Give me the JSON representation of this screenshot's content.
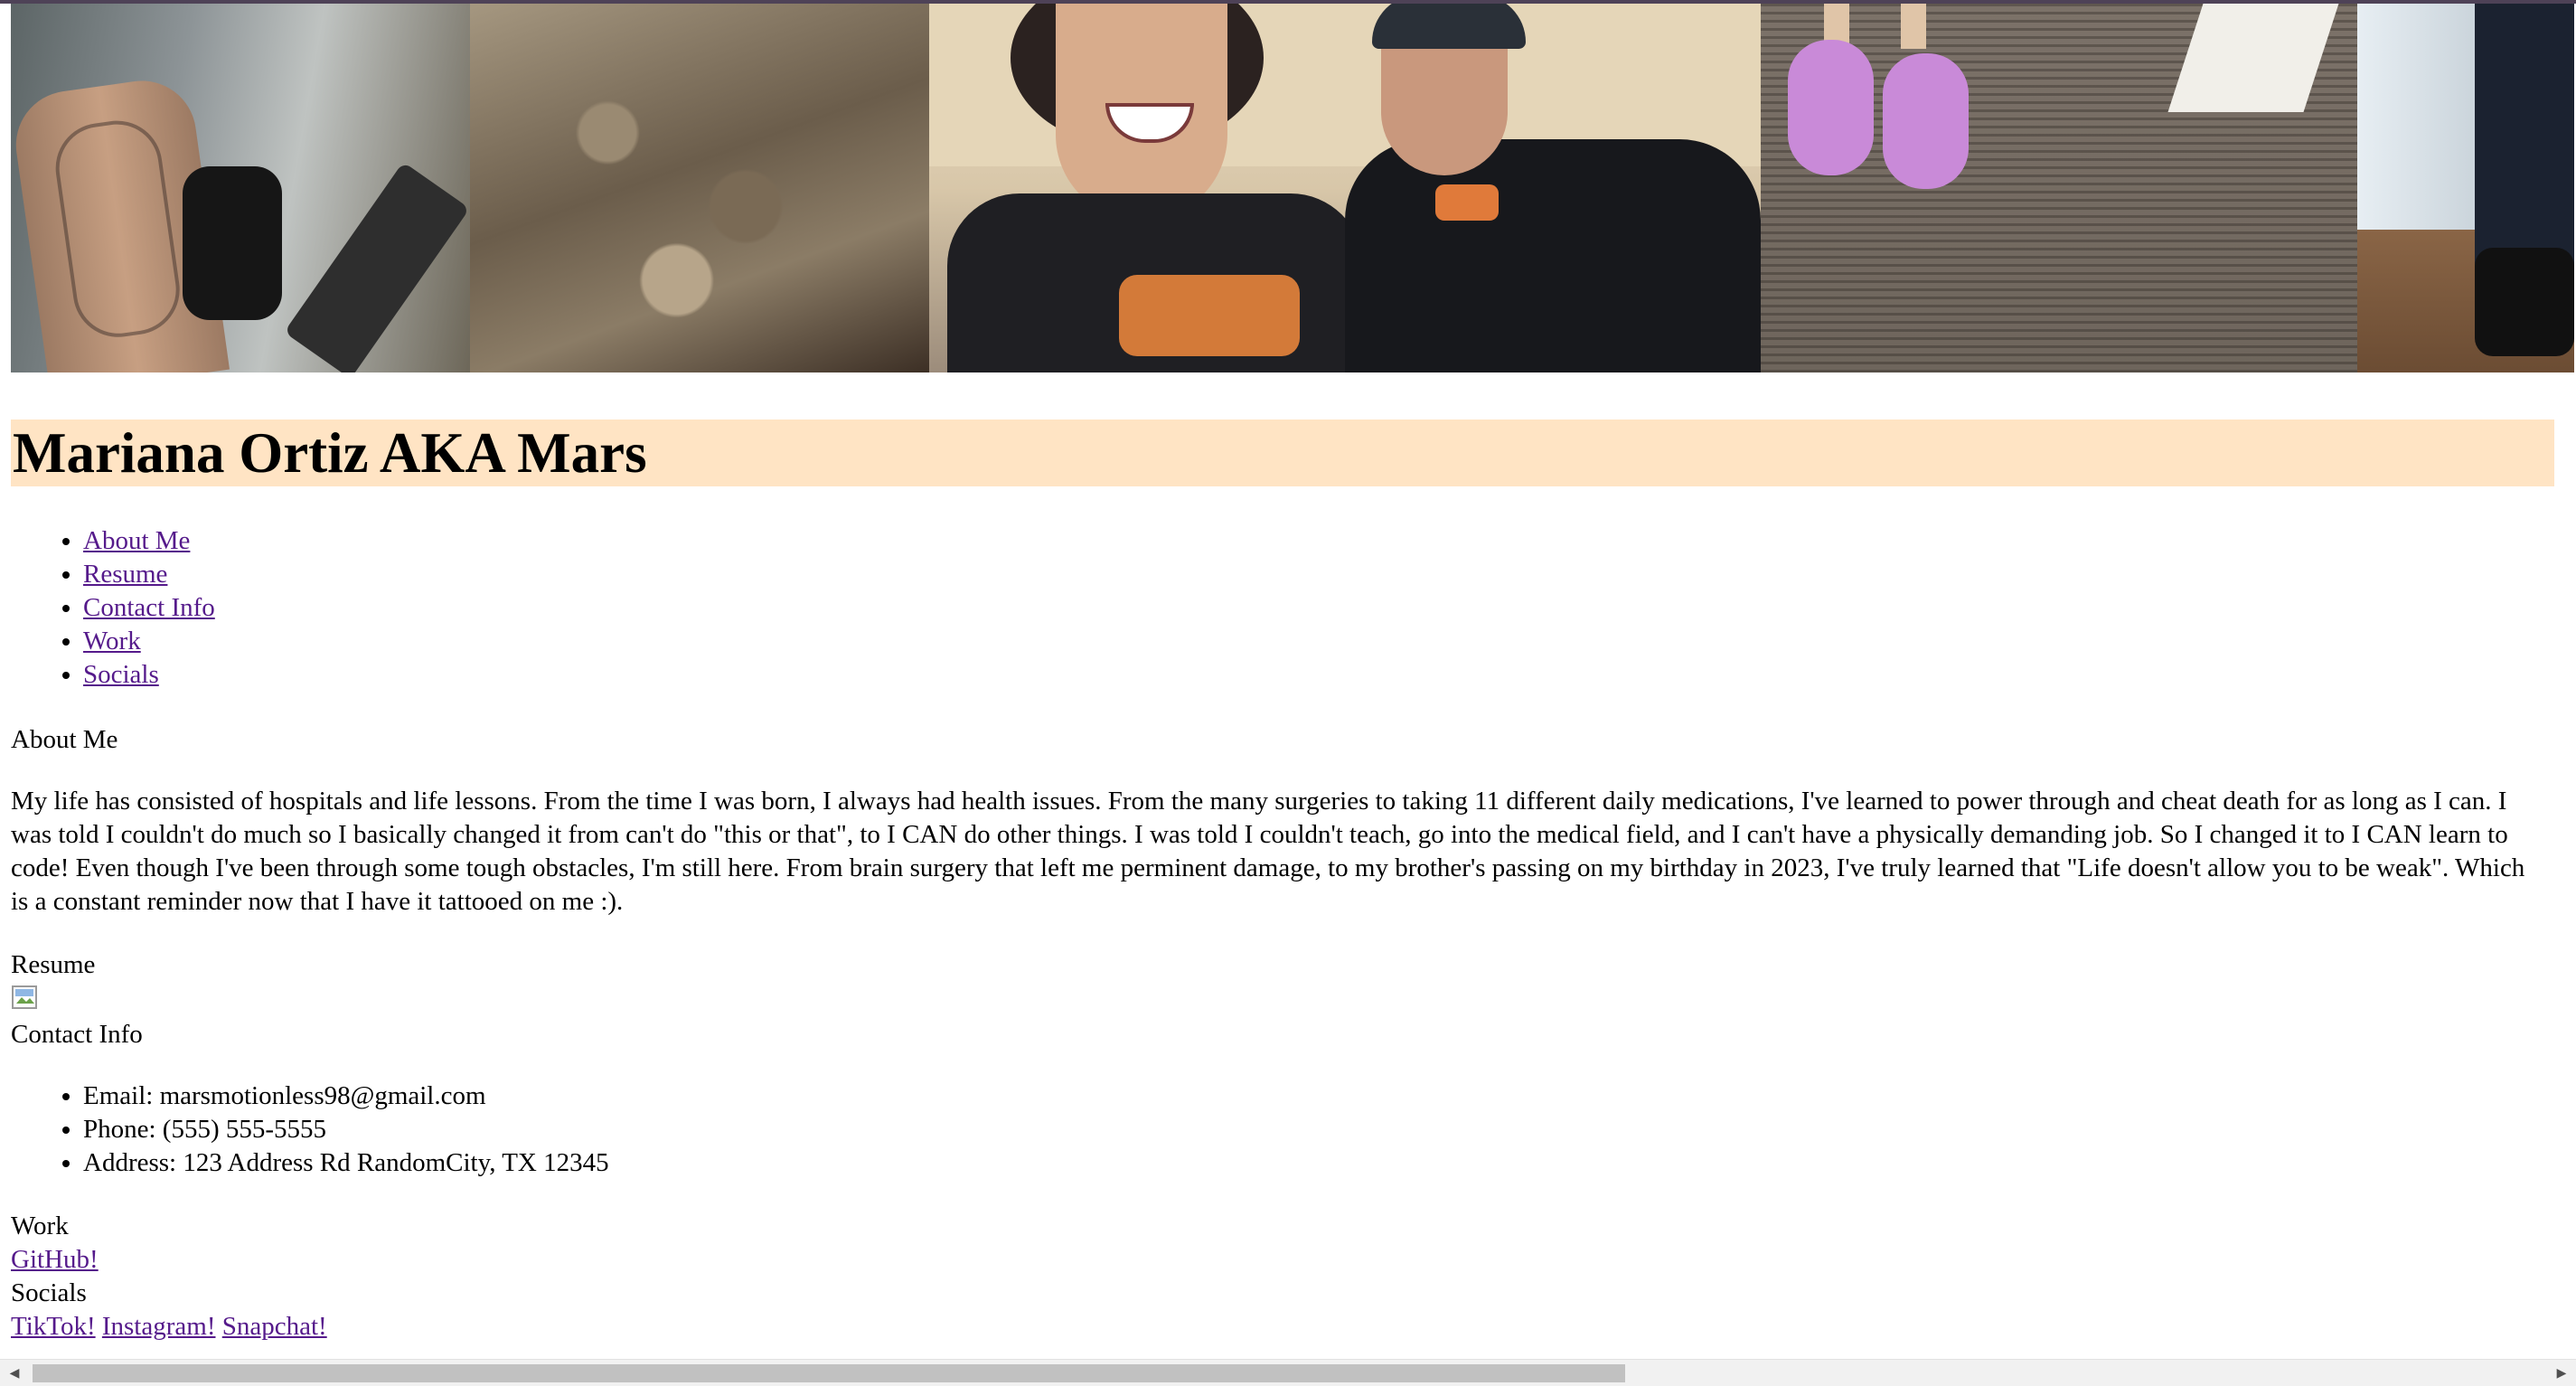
{
  "header": {
    "title": "Mariana Ortiz AKA Mars"
  },
  "nav": {
    "items": [
      {
        "label": "About Me"
      },
      {
        "label": "Resume"
      },
      {
        "label": "Contact Info"
      },
      {
        "label": "Work"
      },
      {
        "label": "Socials"
      }
    ]
  },
  "about": {
    "heading": "About Me",
    "text": "My life has consisted of hospitals and life lessons. From the time I was born, I always had health issues. From the many surgeries to taking 11 different daily medications, I've learned to power through and cheat death for as long as I can. I was told I couldn't do much so I basically changed it from can't do \"this or that\", to I CAN do other things. I was told I couldn't teach, go into the medical field, and I can't have a physically demanding job. So I changed it to I CAN learn to code! Even though I've been through some tough obstacles, I'm still here. From brain surgery that left me perminent damage, to my brother's passing on my birthday in 2023, I've truly learned that \"Life doesn't allow you to be weak\". Which is a constant reminder now that I have it tattooed on me :)."
  },
  "resume": {
    "heading": "Resume"
  },
  "contact": {
    "heading": "Contact Info",
    "items": [
      {
        "text": "Email: marsmotionless98@gmail.com"
      },
      {
        "text": "Phone: (555) 555-5555"
      },
      {
        "text": "Address: 123 Address Rd RandomCity, TX 12345"
      }
    ]
  },
  "work": {
    "heading": "Work",
    "link": "GitHub!"
  },
  "socials": {
    "heading": "Socials",
    "links": [
      {
        "label": "TikTok!"
      },
      {
        "label": "Instagram!"
      },
      {
        "label": "Snapchat!"
      }
    ]
  },
  "colors": {
    "header_bg": "#ffe4c4",
    "link_visited": "#551a8b"
  }
}
